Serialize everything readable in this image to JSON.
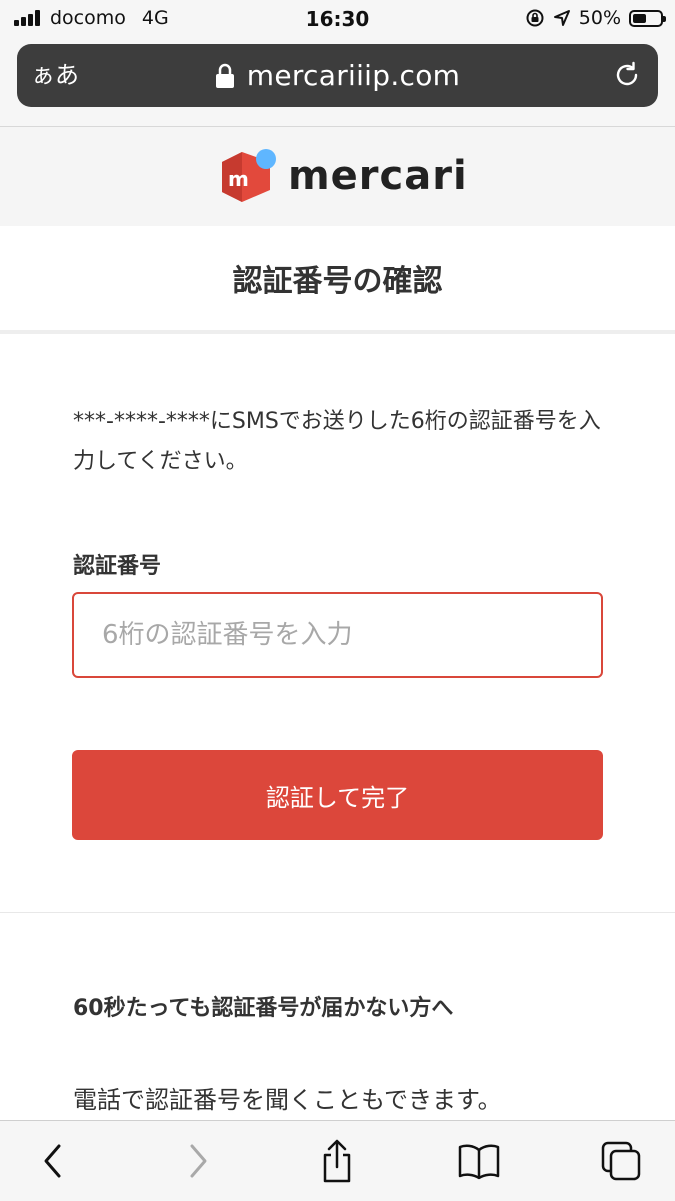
{
  "status_bar": {
    "carrier": "docomo",
    "network": "4G",
    "time": "16:30",
    "battery_percent": "50%",
    "battery_level": 0.5
  },
  "browser": {
    "text_size_label": "ぁあ",
    "url": "mercariiip.com"
  },
  "brand": {
    "logo_text": "mercari",
    "accent_color": "#dc473b",
    "logo_dot_color": "#5fb6ff"
  },
  "page": {
    "title": "認証番号の確認",
    "description": "***-****-****にSMSでお送りした6桁の認証番号を入力してください。",
    "code_label": "認証番号",
    "code_placeholder": "6桁の認証番号を入力",
    "submit_label": "認証して完了",
    "help_heading": "60秒たっても認証番号が届かない方へ",
    "help_text": "電話で認証番号を聞くこともできます。"
  },
  "toolbar": {
    "icons": [
      "chevron-left-icon",
      "chevron-right-icon",
      "share-icon",
      "bookmarks-icon",
      "tabs-icon"
    ]
  }
}
